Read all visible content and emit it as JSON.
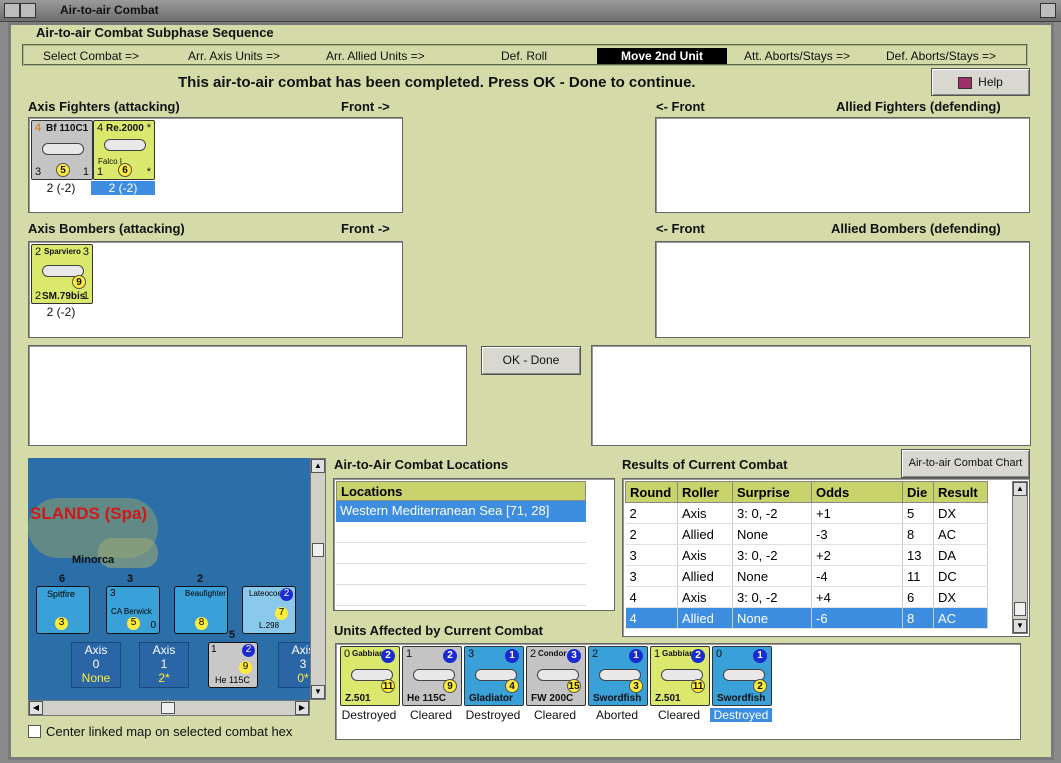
{
  "window": {
    "title": "Air-to-air Combat"
  },
  "subphase": {
    "heading": "Air-to-air Combat Subphase Sequence",
    "steps": [
      "Select Combat =>",
      "Arr. Axis Units =>",
      "Arr. Allied Units =>",
      "Def. Roll",
      "Move 2nd Unit",
      "Att. Aborts/Stays =>",
      "Def. Aborts/Stays =>"
    ],
    "active_step": "Move 2nd Unit"
  },
  "message": "This air-to-air combat has been completed.  Press OK - Done to continue.",
  "help_button": "Help",
  "axis_fighters": {
    "label": "Axis Fighters (attacking)",
    "front": "Front ->",
    "units": [
      {
        "name": "Bf 110C1",
        "tl": "4",
        "bl": "3",
        "br": "1",
        "circle": "5",
        "value": "2 (-2)"
      },
      {
        "name": "Re.2000",
        "sub": "Falco I",
        "tl": "4",
        "tr": "*",
        "bl": "1",
        "br": "*",
        "circle": "6",
        "value": "2 (-2)"
      }
    ]
  },
  "allied_fighters": {
    "label": "Allied Fighters (defending)",
    "front": "<- Front"
  },
  "axis_bombers": {
    "label": "Axis Bombers (attacking)",
    "front": "Front ->",
    "units": [
      {
        "name": "Sparviero",
        "tl": "2",
        "tr": "3",
        "bl": "2",
        "br": "1",
        "model": "SM.79bis",
        "circle": "9",
        "value": "2 (-2)"
      }
    ]
  },
  "allied_bombers": {
    "label": "Allied Bombers (defending)",
    "front": "<- Front"
  },
  "ok_button": "OK - Done",
  "map": {
    "region": "SLANDS (Spa)",
    "place": "Minorca",
    "counters": [
      {
        "name": "Spitfire",
        "top": "6",
        "circle": "3"
      },
      {
        "name": "CA Berwick",
        "top": "3",
        "circle": "5",
        "tl": "3",
        "tr": "5",
        "br": "0"
      },
      {
        "name": "Beaufighter",
        "top": "2",
        "circle": "8"
      },
      {
        "name": "Lateocoere",
        "sub": "L.298",
        "circle": "7",
        "tr": "2"
      },
      {
        "name": "He 115C",
        "top": "5",
        "circle": "9",
        "tr": "2",
        "tl": "1"
      }
    ],
    "axis_boxes": [
      {
        "label": "Axis",
        "value": "0",
        "sub": "None"
      },
      {
        "label": "Axis",
        "value": "1",
        "sub": "2*"
      },
      {
        "label": "Axis",
        "value": "3",
        "sub": "0*"
      }
    ],
    "center_checkbox": "Center linked map on selected combat hex"
  },
  "locations": {
    "label": "Air-to-Air Combat Locations",
    "header": "Locations",
    "items": [
      "Western Mediterranean Sea [71, 28]"
    ]
  },
  "results": {
    "label": "Results of Current Combat",
    "chart_button": "Air-to-air Combat Chart",
    "columns": [
      "Round",
      "Roller",
      "Surprise",
      "Odds",
      "Die",
      "Result"
    ],
    "rows": [
      [
        "2",
        "Axis",
        "3: 0, -2",
        "+1",
        "5",
        "DX"
      ],
      [
        "2",
        "Allied",
        "None",
        "-3",
        "8",
        "AC"
      ],
      [
        "3",
        "Axis",
        "3: 0, -2",
        "+2",
        "13",
        "DA"
      ],
      [
        "3",
        "Allied",
        "None",
        "-4",
        "11",
        "DC"
      ],
      [
        "4",
        "Axis",
        "3: 0, -2",
        "+4",
        "6",
        "DX"
      ],
      [
        "4",
        "Allied",
        "None",
        "-6",
        "8",
        "AC"
      ]
    ]
  },
  "affected": {
    "label": "Units Affected by Current Combat",
    "units": [
      {
        "name": "Gabbiano",
        "model": "Z.501",
        "tl": "0",
        "circle": "11",
        "blue": "2",
        "status": "Destroyed"
      },
      {
        "name": "",
        "model": "He 115C",
        "tl": "1",
        "circle": "9",
        "blue": "2",
        "status": "Cleared"
      },
      {
        "name": "",
        "model": "Gladiator",
        "tl": "3",
        "circle": "4",
        "blue": "1",
        "status": "Destroyed"
      },
      {
        "name": "Condor",
        "model": "FW 200C",
        "tl": "2",
        "circle": "15",
        "blue": "3",
        "status": "Cleared"
      },
      {
        "name": "",
        "model": "Swordfish",
        "tl": "2",
        "circle": "3",
        "blue": "1",
        "status": "Aborted"
      },
      {
        "name": "Gabbiano",
        "model": "Z.501",
        "tl": "1",
        "circle": "11",
        "blue": "2",
        "status": "Cleared"
      },
      {
        "name": "",
        "model": "Swordfish",
        "tl": "0",
        "circle": "2",
        "blue": "1",
        "status": "Destroyed"
      }
    ]
  }
}
